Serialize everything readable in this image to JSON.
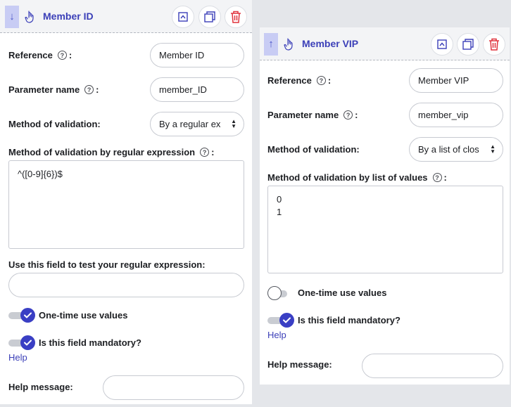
{
  "left_panel": {
    "title": "Member ID",
    "move_arrow": "↓",
    "reference": {
      "label": "Reference",
      "value": "Member ID"
    },
    "parameter_name": {
      "label": "Parameter name",
      "value": "member_ID"
    },
    "method": {
      "label": "Method of validation:",
      "value": "By a regular ex"
    },
    "regex": {
      "label": "Method of validation by regular expression",
      "value": "^([0-9]{6})$"
    },
    "test_field": {
      "label": "Use this field to test your regular expression:",
      "value": ""
    },
    "one_time": {
      "label": "One-time use values",
      "on": true
    },
    "mandatory": {
      "label": "Is this field mandatory?",
      "on": true
    },
    "help_link": "Help",
    "help_message": {
      "label": "Help message:",
      "value": ""
    }
  },
  "right_panel": {
    "title": "Member VIP",
    "move_arrow": "↑",
    "reference": {
      "label": "Reference",
      "value": "Member VIP"
    },
    "parameter_name": {
      "label": "Parameter name",
      "value": "member_vip"
    },
    "method": {
      "label": "Method of validation:",
      "value": "By a list of clos"
    },
    "list": {
      "label": "Method of validation by list of values",
      "value": "0\n1"
    },
    "one_time": {
      "label": "One-time use values",
      "on": false
    },
    "mandatory": {
      "label": "Is this field mandatory?",
      "on": true
    },
    "help_link": "Help",
    "help_message": {
      "label": "Help message:",
      "value": ""
    }
  },
  "help_glyph": "?",
  "colon": ":",
  "colors": {
    "accent": "#3a3fc4",
    "delete": "#e0323c",
    "move_button": "#c8ccf4"
  },
  "icons": {
    "type": "hand-pointer-icon",
    "collapse": "collapse-icon",
    "duplicate": "duplicate-icon",
    "delete": "trash-icon"
  }
}
